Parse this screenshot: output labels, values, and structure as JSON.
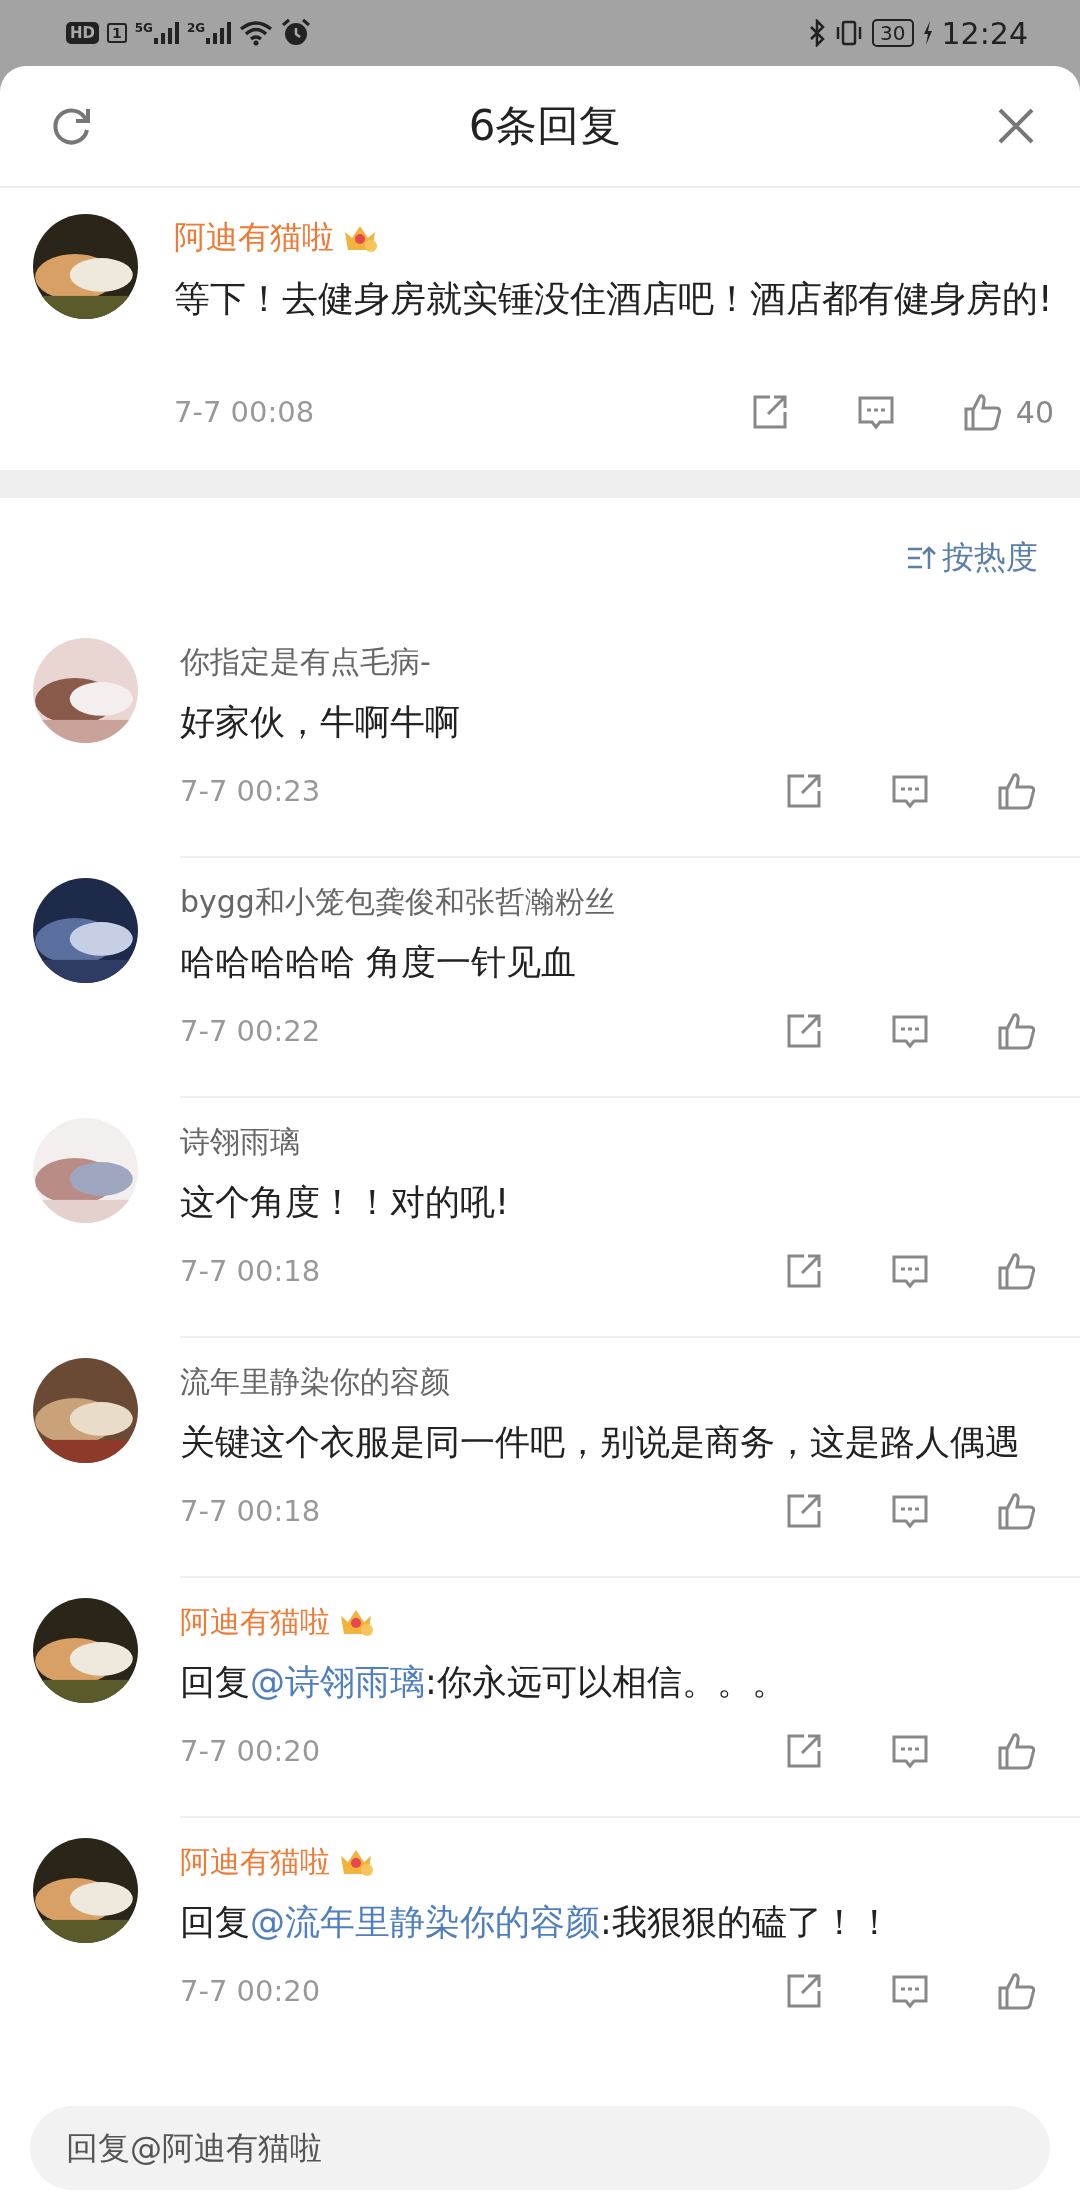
{
  "status_bar": {
    "hd": "HD",
    "sim": "1",
    "networks": [
      "5G",
      "2G"
    ],
    "battery": "30",
    "time": "12:24"
  },
  "header": {
    "title": "6条回复"
  },
  "main_comment": {
    "author": "阿迪有猫啦",
    "vip": true,
    "text": "等下！去健身房就实锤没住酒店吧！酒店都有健身房的!",
    "time": "7-7 00:08",
    "likes": "40"
  },
  "sort": {
    "label": "按热度"
  },
  "replies": [
    {
      "author": "你指定是有点毛病-",
      "vip": false,
      "text": [
        {
          "kind": "plain",
          "text": "好家伙，牛啊牛啊"
        }
      ],
      "time": "7-7 00:23"
    },
    {
      "author": "bygg和小笼包龚俊和张哲瀚粉丝",
      "vip": false,
      "text": [
        {
          "kind": "plain",
          "text": "哈哈哈哈哈 角度一针见血"
        }
      ],
      "time": "7-7 00:22"
    },
    {
      "author": "诗翎雨璃",
      "vip": false,
      "text": [
        {
          "kind": "plain",
          "text": "这个角度！！对的吼!"
        }
      ],
      "time": "7-7 00:18"
    },
    {
      "author": "流年里静染你的容颜",
      "vip": false,
      "text": [
        {
          "kind": "plain",
          "text": "关键这个衣服是同一件吧，别说是商务，这是路人偶遇"
        }
      ],
      "time": "7-7 00:18"
    },
    {
      "author": "阿迪有猫啦",
      "vip": true,
      "text": [
        {
          "kind": "plain",
          "text": "回复"
        },
        {
          "kind": "mention",
          "text": "@诗翎雨璃"
        },
        {
          "kind": "plain",
          "text": ":你永远可以相信。。。"
        }
      ],
      "time": "7-7 00:20"
    },
    {
      "author": "阿迪有猫啦",
      "vip": true,
      "text": [
        {
          "kind": "plain",
          "text": "回复"
        },
        {
          "kind": "mention",
          "text": "@流年里静染你的容颜"
        },
        {
          "kind": "plain",
          "text": ":我狠狠的磕了！！"
        }
      ],
      "time": "7-7 00:20"
    }
  ],
  "reply_box": {
    "placeholder": "回复@阿迪有猫啦"
  }
}
